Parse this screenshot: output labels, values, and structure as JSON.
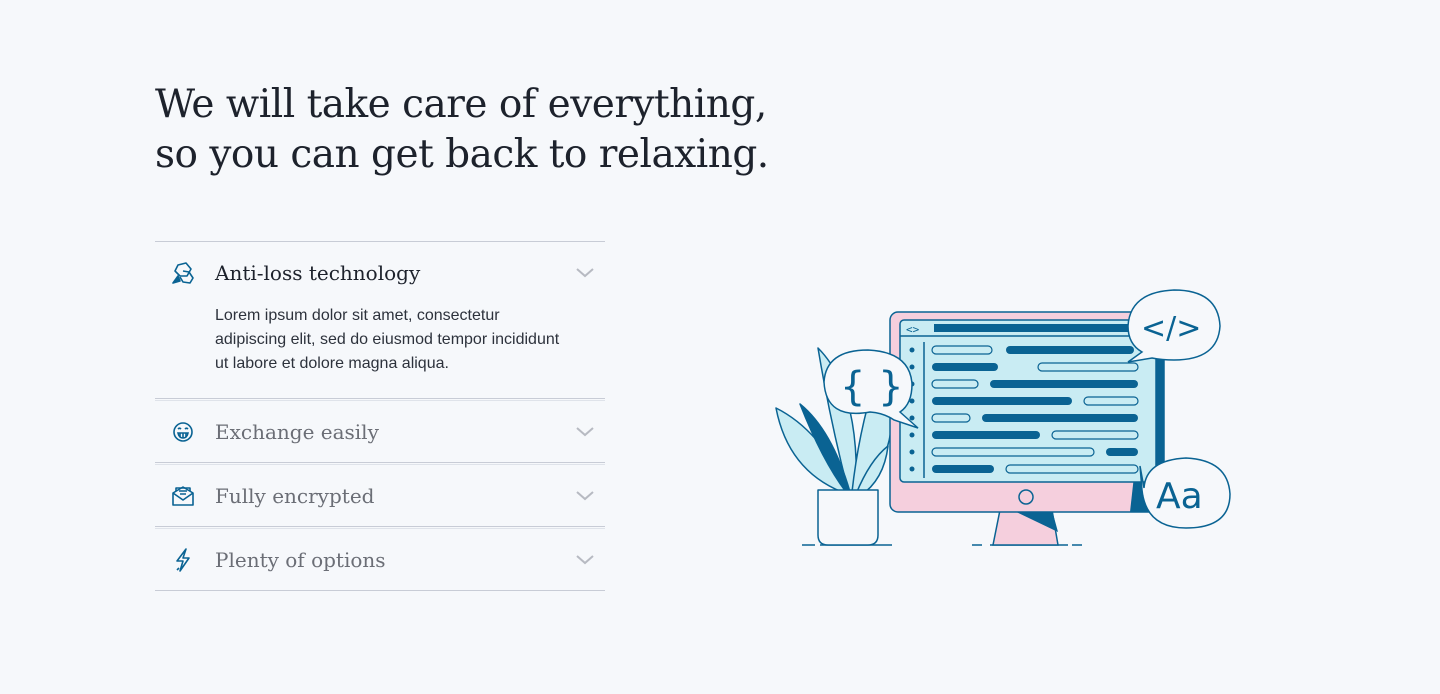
{
  "heading": {
    "line1": "We will take care of everything,",
    "line2": "so you can get back to relaxing."
  },
  "accordion": {
    "items": [
      {
        "title": "Anti-loss technology",
        "icon": "bubbles-icon",
        "open": true,
        "body": "Lorem ipsum dolor sit amet, consectetur adipiscing elit, sed do eiusmod tempor incididunt ut labore et dolore magna aliqua."
      },
      {
        "title": "Exchange easily",
        "icon": "grin-face-icon",
        "open": false
      },
      {
        "title": "Fully encrypted",
        "icon": "envelope-icon",
        "open": false
      },
      {
        "title": "Plenty of options",
        "icon": "lightning-icon",
        "open": false
      }
    ]
  },
  "illustration": {
    "curly_bubble": "{ }",
    "code_bubble": "</>",
    "font_bubble": "Aa",
    "browser_tag": "<>"
  },
  "colors": {
    "background": "#f6f8fb",
    "navy": "#0a6393",
    "light_blue": "#c9ecf3",
    "pink": "#f5cfdd",
    "divider": "#c8ccd6"
  }
}
